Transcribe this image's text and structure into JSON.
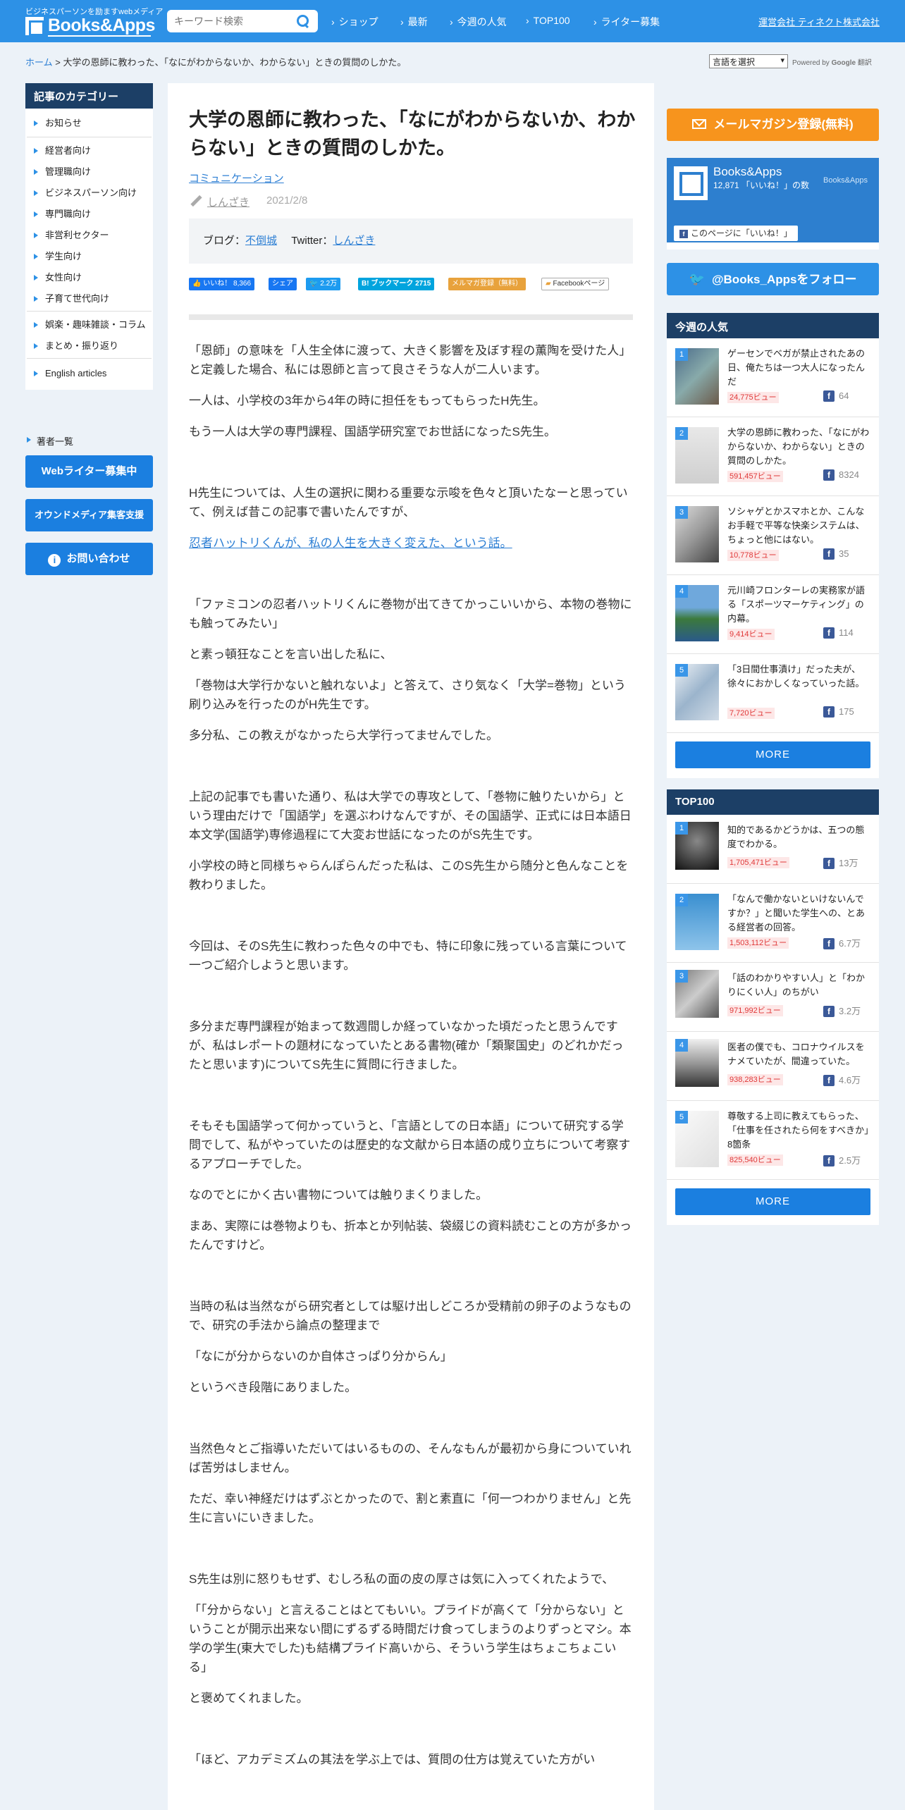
{
  "header": {
    "tagline": "ビジネスパーソンを励ますwebメディア",
    "site_name": "Books&Apps",
    "search_placeholder": "キーワード検索",
    "nav": [
      "ショップ",
      "最新",
      "今週の人気",
      "TOP100",
      "ライター募集"
    ],
    "company": "運営会社 ティネクト株式会社"
  },
  "breadcrumb": {
    "home": "ホーム",
    "sep": " > ",
    "current": "大学の恩師に教わった、「なにがわからないか、わからない」ときの質問のしかた。"
  },
  "translate": {
    "select_label": "言語を選択",
    "powered": "Powered by",
    "google": "Google",
    "translate": "翻訳"
  },
  "sidebar": {
    "heading": "記事のカテゴリー",
    "groups": [
      [
        "お知らせ"
      ],
      [
        "経営者向け",
        "管理職向け",
        "ビジネスパーソン向け",
        "専門職向け",
        "非営利セクター",
        "学生向け",
        "女性向け",
        "子育て世代向け"
      ],
      [
        "娯楽・趣味雑談・コラム",
        "まとめ・振り返り"
      ],
      [
        "English articles"
      ]
    ],
    "writers": "著者一覧",
    "buttons": [
      "Webライター募集中",
      "オウンドメディア集客支援",
      "お問い合わせ"
    ]
  },
  "article": {
    "title": "大学の恩師に教わった、「なにがわからないか、わからない」ときの質問のしかた。",
    "category": "コミュニケーション",
    "author": "しんざき",
    "date": "2021/2/8",
    "blog_label": "ブログ：",
    "blog_name": "不倒城",
    "twitter_label": "Twitter：",
    "twitter_name": "しんざき",
    "share": {
      "like": "いいね！ 8,366",
      "fb_share": "シェア",
      "tweet": "2.2万",
      "bookmark": "ブックマーク 2715",
      "mailmag": "メルマガ登録（無料）",
      "fbpage": "Facebookページ"
    },
    "paragraphs": [
      "「恩師」の意味を「人生全体に渡って、大きく影響を及ぼす程の薫陶を受けた人」と定義した場合、私には恩師と言って良さそうな人が二人います。",
      "一人は、小学校の3年から4年の時に担任をもってもらったH先生。",
      "もう一人は大学の専門課程、国語学研究室でお世話になったS先生。",
      "H先生については、人生の選択に関わる重要な示唆を色々と頂いたなーと思っていて、例えば昔この記事で書いたんですが、",
      "忍者ハットリくんが、私の人生を大きく変えた、という話。",
      "「ファミコンの忍者ハットリくんに巻物が出てきてかっこいいから、本物の巻物にも触ってみたい」",
      "と素っ頓狂なことを言い出した私に、",
      "「巻物は大学行かないと触れないよ」と答えて、さり気なく「大学=巻物」という刷り込みを行ったのがH先生です。",
      "多分私、この教えがなかったら大学行ってませんでした。",
      "上記の記事でも書いた通り、私は大学での専攻として、「巻物に触りたいから」という理由だけで「国語学」を選ぶわけなんですが、その国語学、正式には日本語日本文学(国語学)専修過程にて大変お世話になったのがS先生です。",
      "小学校の時と同様ちゃらんぽらんだった私は、このS先生から随分と色んなことを教わりました。",
      "今回は、そのS先生に教わった色々の中でも、特に印象に残っている言葉について一つご紹介しようと思います。",
      "多分まだ専門課程が始まって数週間しか経っていなかった頃だったと思うんですが、私はレポートの題材になっていたとある書物(確か「類聚国史」のどれかだったと思います)についてS先生に質問に行きました。",
      "そもそも国語学って何かっていうと、「言語としての日本語」について研究する学問でして、私がやっていたのは歴史的な文献から日本語の成り立ちについて考察するアプローチでした。",
      "なのでとにかく古い書物については触りまくりました。",
      "まあ、実際には巻物よりも、折本とか列帖装、袋綴じの資料読むことの方が多かったんですけど。",
      "当時の私は当然ながら研究者としては駆け出しどころか受精前の卵子のようなもので、研究の手法から論点の整理まで",
      "「なにが分からないのか自体さっぱり分からん」",
      "というべき段階にありました。",
      "当然色々とご指導いただいてはいるものの、そんなもんが最初から身についていれば苦労はしません。",
      "ただ、幸い神経だけはずぶとかったので、割と素直に「何一つわかりません」と先生に言いにいきました。",
      "S先生は別に怒りもせず、むしろ私の面の皮の厚さは気に入ってくれたようで、",
      "「「分からない」と言えることはとてもいい。プライドが高くて「分からない」ということが開示出来ない間にずるずる時間だけ食ってしまうのよりずっとマシ。本学の学生(東大でした)も結構プライド高いから、そういう学生はちょこちょこいる」",
      "と褒めてくれました。",
      "「ほど、アカデミズムの其法を学ぶ上では、質問の仕方は覚えていた方がい"
    ]
  },
  "right": {
    "mail_button": "メールマガジン登録(無料)",
    "fb_name": "Books&Apps",
    "fb_likes": "12,871 「いいね！」の数",
    "fb_like_button": "このページに「いいね！」",
    "twitter_follow": "@Books_Appsをフォロー",
    "weekly": {
      "heading": "今週の人気",
      "items": [
        {
          "title": "ゲーセンでベガが禁止されたあの日、俺たちは一つ大人になったんだ",
          "views": "24,775ビュー",
          "fb": "64"
        },
        {
          "title": "大学の恩師に教わった、「なにがわからないか、わからない」ときの質問のしかた。",
          "views": "591,457ビュー",
          "fb": "8324"
        },
        {
          "title": "ソシャゲとかスマホとか、こんなお手軽で平等な快楽システムは、ちょっと他にはない。",
          "views": "10,778ビュー",
          "fb": "35"
        },
        {
          "title": "元川崎フロンターレの実務家が語る「スポーツマーケティング」の内幕。",
          "views": "9,414ビュー",
          "fb": "114"
        },
        {
          "title": "「3日間仕事漬け」だった夫が、徐々におかしくなっていった話。",
          "views": "7,720ビュー",
          "fb": "175"
        }
      ],
      "more": "MORE"
    },
    "top100": {
      "heading": "TOP100",
      "items": [
        {
          "title": "知的であるかどうかは、五つの態度でわかる。",
          "views": "1,705,471ビュー",
          "fb": "13万"
        },
        {
          "title": "「なんで働かないといけないんですか？」と聞いた学生への、とある経営者の回答。",
          "views": "1,503,112ビュー",
          "fb": "6.7万"
        },
        {
          "title": "「話のわかりやすい人」と「わかりにくい人」のちがい",
          "views": "971,992ビュー",
          "fb": "3.2万"
        },
        {
          "title": "医者の僕でも、コロナウイルスをナメていたが、間違っていた。",
          "views": "938,283ビュー",
          "fb": "4.6万"
        },
        {
          "title": "尊敬する上司に教えてもらった、「仕事を任されたら何をすべきか」8箇条",
          "views": "825,540ビュー",
          "fb": "2.5万"
        }
      ],
      "more": "MORE"
    }
  },
  "colors": {
    "header": "#2d91e6",
    "navy": "#1c3f66",
    "button": "#1b7fe0",
    "mail": "#f7941d",
    "twitter": "#2d91e6"
  }
}
